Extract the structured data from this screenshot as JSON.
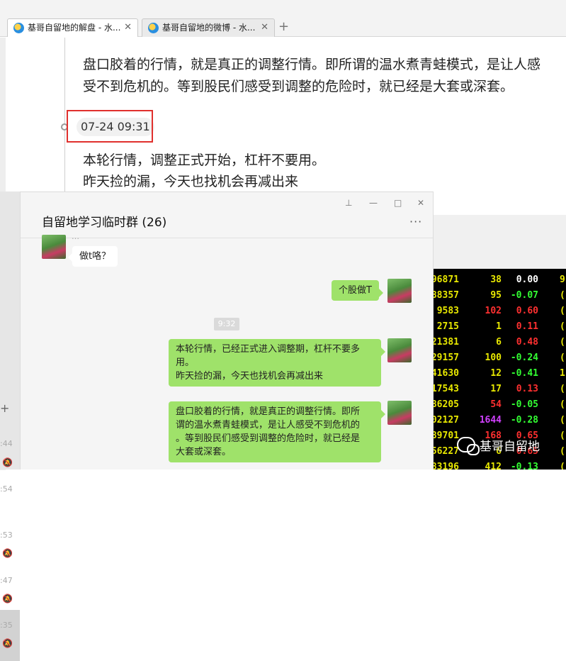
{
  "browser": {
    "tabs": [
      {
        "label": "基哥自留地的解盘 - 水...",
        "close": "✕"
      },
      {
        "label": "基哥自留地的微博 - 水...",
        "close": "✕"
      }
    ],
    "new_tab": "+"
  },
  "article": {
    "para1_line1": "盘口胶着的行情，就是真正的调整行情。即所谓的温水煮青蛙模式，是让人感",
    "para1_line2": "受不到危机的。等到股民们感受到调整的危险时，就已经是大套或深套。",
    "time": "07-24 09:31",
    "para2_line1": "本轮行情，调整正式开始，杠杆不要用。",
    "para2_line2": "昨天捡的漏，今天也找机会再减出来"
  },
  "chat": {
    "title": "自留地学习临时群 (26)",
    "more": "···",
    "controls": {
      "pin": "⊥",
      "minimize": "—",
      "maximize": "□",
      "close": "✕"
    },
    "sender_partial": "…",
    "messages": [
      {
        "dir": "in",
        "text": "做t咯？"
      },
      {
        "dir": "out",
        "text": "个股做T"
      },
      {
        "dir": "out",
        "lines": [
          "本轮行情，已经正式进入调整期，杠杆不要多",
          "用。",
          "昨天捡的漏，今天也找机会再减出来"
        ]
      },
      {
        "dir": "out",
        "lines": [
          "盘口胶着的行情，就是真正的调整行情。即所",
          "谓的温水煮青蛙模式，是让人感受不到危机的",
          "。等到股民们感受到调整的危险时，就已经是",
          "大套或深套。"
        ]
      }
    ],
    "timestamp": "9:32"
  },
  "sidebar": {
    "plus": "+",
    "times": [
      ":44",
      ":54",
      ":53",
      ":47",
      ":35"
    ]
  },
  "stock_rows": [
    {
      "code": "96871",
      "vol": "38",
      "vol_color": "#e8e800",
      "chg": "0.00",
      "chg_color": "#ffffff",
      "tail": "9"
    },
    {
      "code": "88357",
      "vol": "95",
      "vol_color": "#e8e800",
      "chg": "-0.07",
      "chg_color": "#33ff33",
      "tail": "("
    },
    {
      "code": "9583",
      "vol": "102",
      "vol_color": "#ff3030",
      "chg": "0.60",
      "chg_color": "#ff3030",
      "tail": "("
    },
    {
      "code": "2715",
      "vol": "1",
      "vol_color": "#e8e800",
      "chg": "0.11",
      "chg_color": "#ff3030",
      "tail": "("
    },
    {
      "code": "21381",
      "vol": "6",
      "vol_color": "#e8e800",
      "chg": "0.48",
      "chg_color": "#ff3030",
      "tail": "("
    },
    {
      "code": "29157",
      "vol": "100",
      "vol_color": "#e8e800",
      "chg": "-0.24",
      "chg_color": "#33ff33",
      "tail": "("
    },
    {
      "code": "41630",
      "vol": "12",
      "vol_color": "#e8e800",
      "chg": "-0.41",
      "chg_color": "#33ff33",
      "tail": "1"
    },
    {
      "code": "17543",
      "vol": "17",
      "vol_color": "#e8e800",
      "chg": "0.13",
      "chg_color": "#ff3030",
      "tail": "("
    },
    {
      "code": "86205",
      "vol": "54",
      "vol_color": "#ff3030",
      "chg": "-0.05",
      "chg_color": "#33ff33",
      "tail": "("
    },
    {
      "code": "02127",
      "vol": "1644",
      "vol_color": "#d040ff",
      "chg": "-0.28",
      "chg_color": "#33ff33",
      "tail": "("
    },
    {
      "code": "89701",
      "vol": "168",
      "vol_color": "#ff3030",
      "chg": "0.65",
      "chg_color": "#ff3030",
      "tail": "("
    },
    {
      "code": "56227",
      "vol": "6",
      "vol_color": "#e8e800",
      "chg": "0.65",
      "chg_color": "#ff3030",
      "tail": "("
    },
    {
      "code": "83196",
      "vol": "412",
      "vol_color": "#e8e800",
      "chg": "-0.13",
      "chg_color": "#33ff33",
      "tail": "("
    }
  ],
  "watermark": "基哥自留地"
}
